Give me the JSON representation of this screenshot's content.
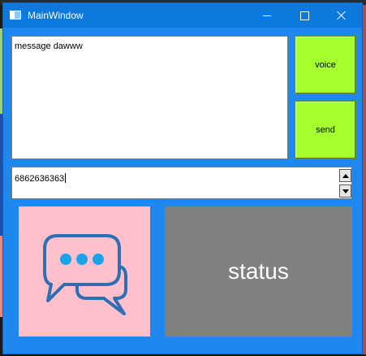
{
  "window": {
    "title": "MainWindow",
    "accent_color": "#1e88f0",
    "titlebar_color": "#0e79dc"
  },
  "titlebar_controls": {
    "minimize_icon": "minimize-icon",
    "maximize_icon": "maximize-icon",
    "close_icon": "close-icon"
  },
  "message_box": {
    "value": "message dawww"
  },
  "buttons": {
    "voice_label": "voice",
    "send_label": "send",
    "color": "#a6ff2e"
  },
  "spin_box": {
    "value": "6862636363",
    "up_icon": "arrow-up-icon",
    "down_icon": "arrow-down-icon"
  },
  "chat_panel": {
    "icon": "chat-bubbles-icon",
    "background": "#ffc0cb"
  },
  "status_panel": {
    "label": "status",
    "background": "#808080"
  }
}
